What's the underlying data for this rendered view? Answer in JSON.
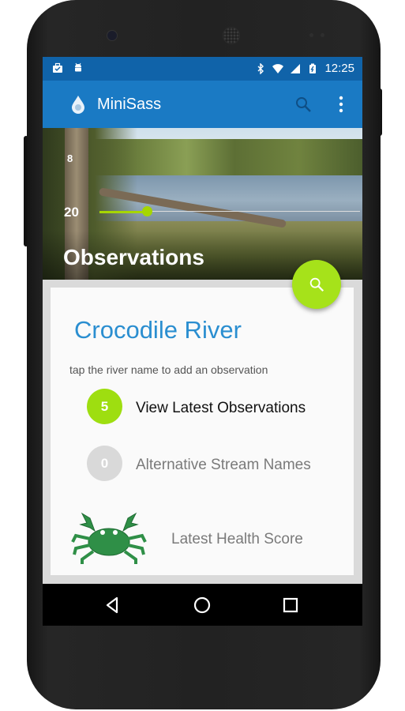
{
  "status_bar": {
    "time": "12:25",
    "icons_left": [
      "briefcase-icon",
      "android-icon"
    ],
    "icons_right": [
      "bluetooth-icon",
      "wifi-icon",
      "signal-icon",
      "battery-icon"
    ]
  },
  "app_bar": {
    "title": "MiniSass",
    "logo": "water-drop-logo",
    "actions": [
      "search-icon",
      "overflow-menu-icon"
    ]
  },
  "hero": {
    "title": "Observations",
    "slider": {
      "top_label": "8",
      "value_label": "20",
      "fill_fraction": 0.18
    }
  },
  "card": {
    "river_name": "Crocodile River",
    "hint": "tap the river name to add an observation",
    "rows": [
      {
        "count": "5",
        "label": "View Latest Observations"
      },
      {
        "count": "0",
        "label": "Alternative Stream Names"
      }
    ],
    "health_label": "Latest Health Score"
  },
  "colors": {
    "status_bar": "#1063a9",
    "app_bar": "#1a7ac4",
    "accent_green": "#a6e21a",
    "river_blue": "#2a8ed0",
    "crab_green": "#2f8f47"
  },
  "nav_bar": [
    "back-icon",
    "home-icon",
    "recents-icon"
  ]
}
